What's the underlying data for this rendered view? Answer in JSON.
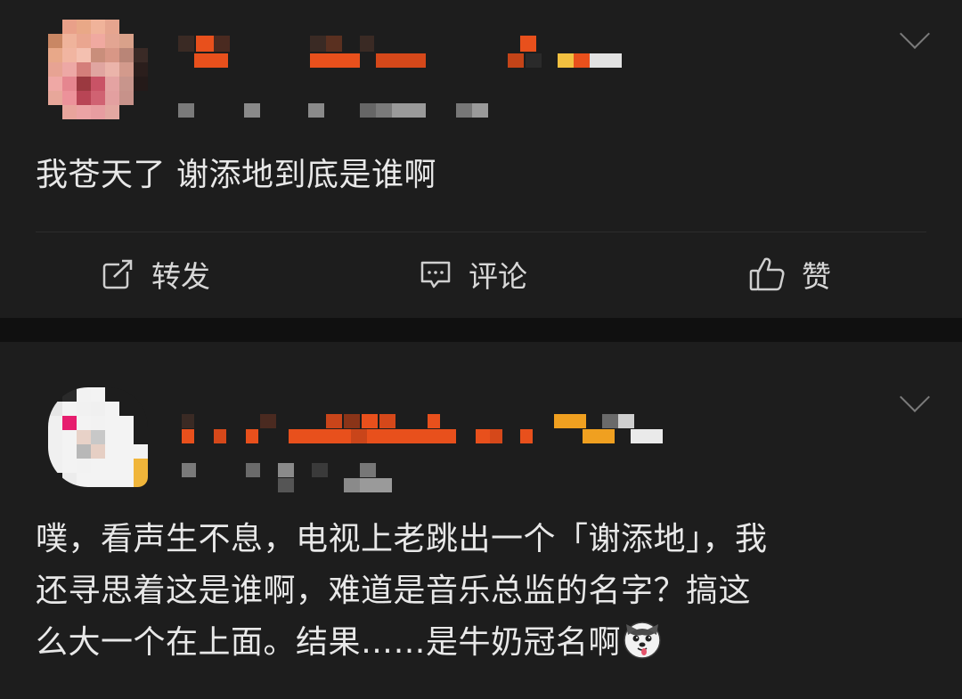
{
  "colors": {
    "background": "#0b0b0b",
    "card": "#1d1d1d",
    "text": "#e8e8e8",
    "redacted_orange": "#e8501c",
    "redacted_gray": "#8a8a8a"
  },
  "posts": [
    {
      "content": "我苍天了 谢添地到底是谁啊",
      "actions": {
        "repost_label": "转发",
        "comment_label": "评论",
        "like_label": "赞"
      }
    },
    {
      "content_line1": "噗，看声生不息，电视上老跳出一个「谢添地」，我",
      "content_line2": "还寻思着这是谁啊，难道是音乐总监的名字？搞这",
      "content_line3": "么大一个在上面。结果……是牛奶冠名啊",
      "emoji_icon": "husky-emoji-icon"
    }
  ]
}
